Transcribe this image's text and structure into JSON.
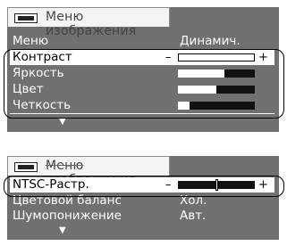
{
  "menu1": {
    "title": "Меню изображения",
    "rows": [
      {
        "label": "Меню",
        "value": "Динамич."
      },
      {
        "label": "Контраст",
        "minus": "–",
        "plus": "+",
        "level": 0.0
      },
      {
        "label": "Яркость",
        "level": 0.6
      },
      {
        "label": "Цвет",
        "level": 0.5
      },
      {
        "label": "Четкость",
        "level": 0.15
      }
    ],
    "more": "▼"
  },
  "menu2": {
    "title": "Меню изображения",
    "rows": [
      {
        "label": "NTSC-Растр.",
        "minus": "–",
        "plus": "+",
        "level": 0.5
      },
      {
        "label": "Цветовой баланс",
        "value": "Хол."
      },
      {
        "label": "Шумопонижение",
        "value": "Авт."
      }
    ],
    "more": "▼"
  }
}
